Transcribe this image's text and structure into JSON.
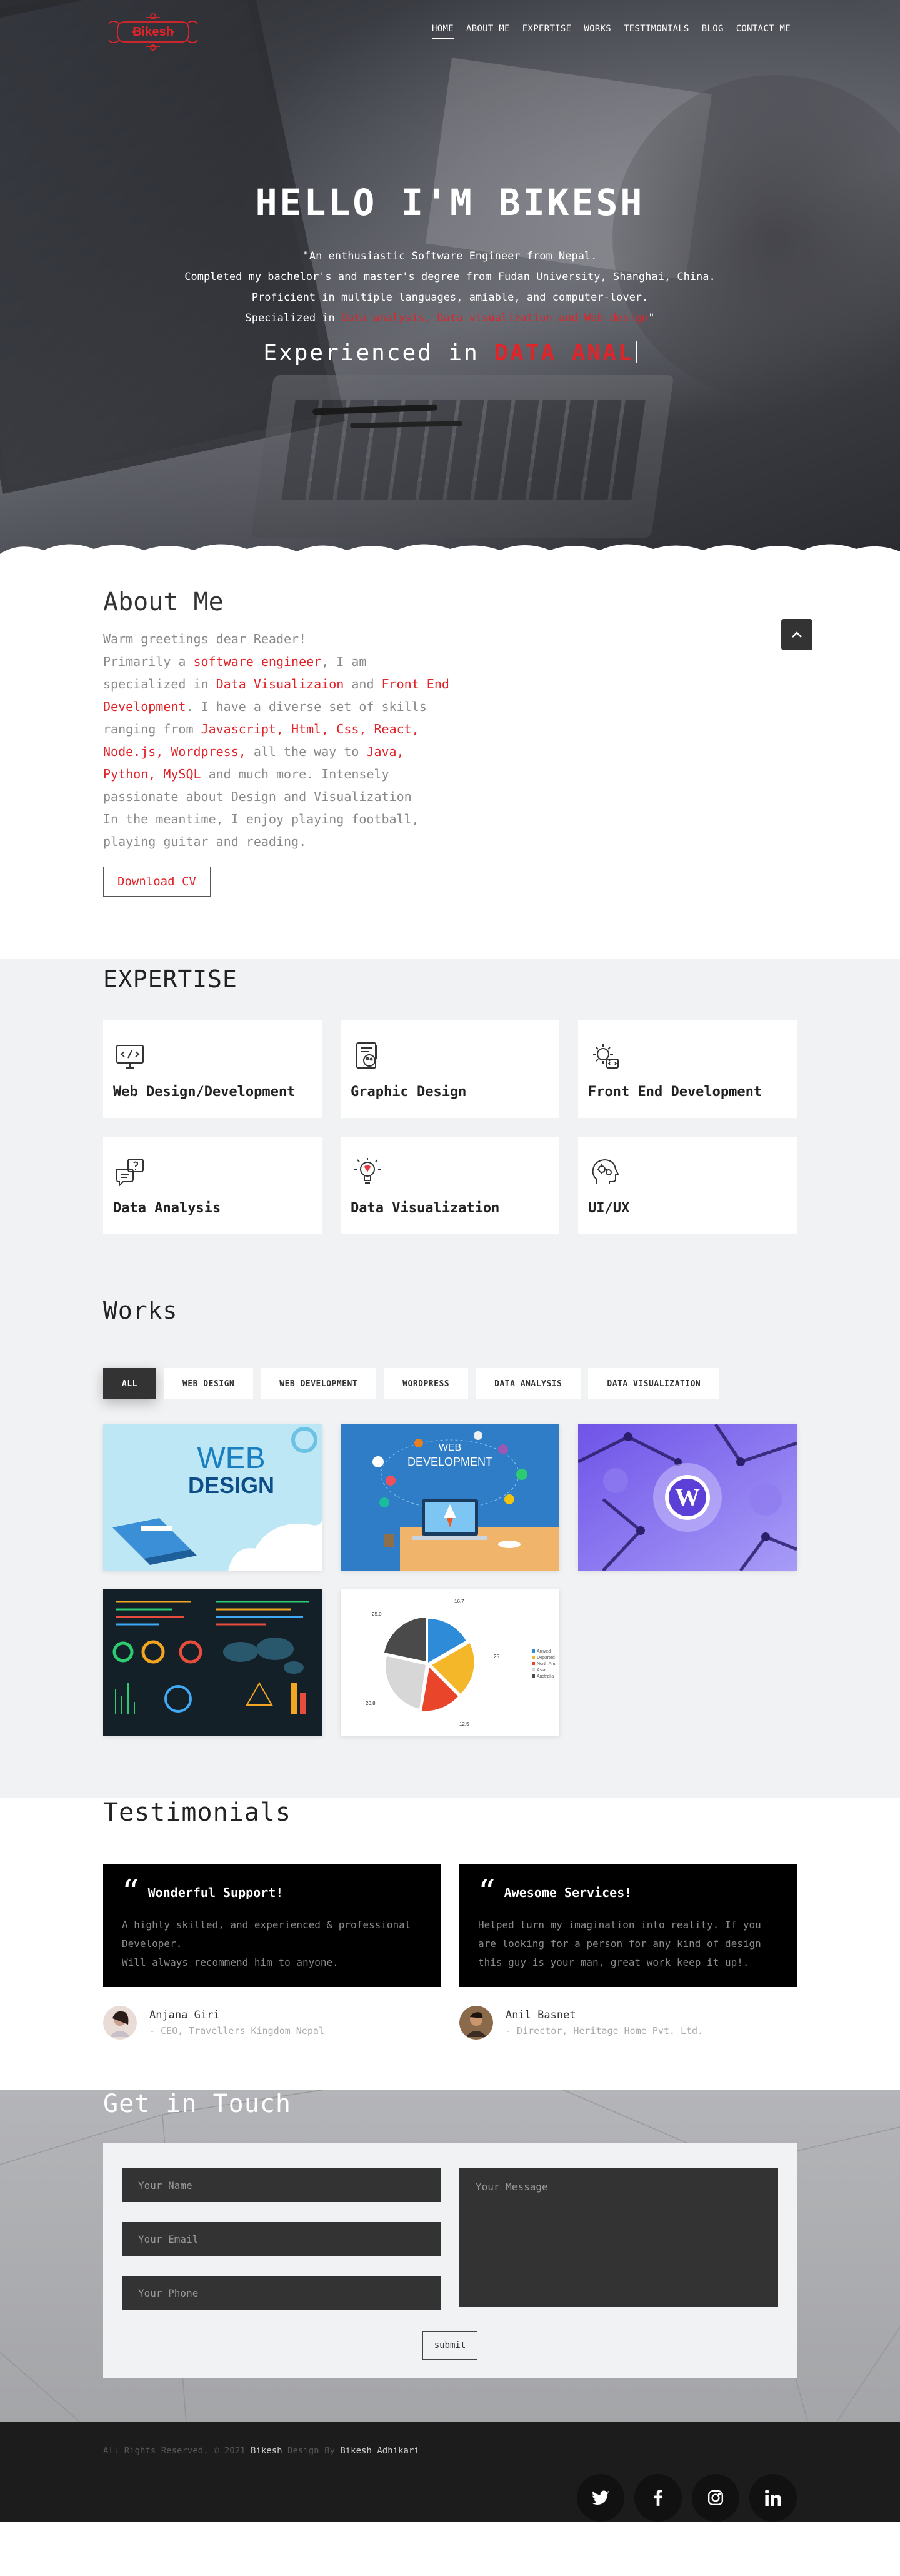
{
  "nav": {
    "logo_text": "Bikesh",
    "links": [
      "HOME",
      "ABOUT ME",
      "EXPERTISE",
      "WORKS",
      "TESTIMONIALS",
      "BLOG",
      "CONTACT ME"
    ]
  },
  "hero": {
    "title": "HELLO I'M BIKESH",
    "line1": "\"An enthusiastic Software Engineer from Nepal.",
    "line2": "Completed my bachelor's and master's degree from Fudan University, Shanghai, China.",
    "line3": "Proficient in multiple languages, amiable, and computer-lover.",
    "line4_prefix": "Specialized in ",
    "line4_red": "Data analysis, Data visualization and Web design",
    "line4_suffix": "\"",
    "typed_prefix": "Experienced in ",
    "typed_value": "DATA ANAL"
  },
  "about": {
    "heading": "About Me",
    "p1": "Warm greetings dear Reader!",
    "p2a": "Primarily a ",
    "p2b": "software engineer",
    "p2c": ", I am specialized in ",
    "p2d": "Data Visualizaion",
    "p2e": " and ",
    "p2f": "Front End Development",
    "p2g": ". I have a diverse set of skills ranging from ",
    "p2h": "Javascript, Html, Css, React, Node.js, Wordpress,",
    "p2i": " all the way to ",
    "p2j": "Java, Python, MySQL",
    "p2k": " and much more. Intensely passionate about Design and Visualization",
    "p3": "In the meantime, I enjoy playing football, playing guitar and reading.",
    "download_label": "Download CV"
  },
  "expertise": {
    "heading": "EXPERTISE",
    "items": [
      {
        "title": "Web Design/Development",
        "icon": "monitor-code-icon"
      },
      {
        "title": "Graphic Design",
        "icon": "palette-document-icon"
      },
      {
        "title": "Front End Development",
        "icon": "gear-code-icon"
      },
      {
        "title": "Data Analysis",
        "icon": "chat-question-icon"
      },
      {
        "title": "Data Visualization",
        "icon": "lightbulb-icon"
      },
      {
        "title": "UI/UX",
        "icon": "head-gears-icon"
      }
    ]
  },
  "works": {
    "heading": "Works",
    "filters": [
      "ALL",
      "WEB DESIGN",
      "WEB DEVELOPMENT",
      "WORDPRESS",
      "DATA ANALYSIS",
      "DATA VISUALIZATION"
    ],
    "web_design_text_1": "WEB",
    "web_design_text_2": "DESIGN",
    "web_dev_text_1": "WEB",
    "web_dev_text_2": "DEVELOPMENT",
    "pie_labels": [
      "16.7",
      "25",
      "12.5",
      "20.8",
      "25.0"
    ],
    "pie_legend": [
      "Arrived",
      "Departed",
      "North Am.",
      "Asia",
      "Australia"
    ]
  },
  "testimonials": {
    "heading": "Testimonials",
    "items": [
      {
        "title": "Wonderful Support!",
        "body": "A highly skilled, and experienced & professional Developer.\nWill always recommend him to anyone.",
        "name": "Anjana Giri",
        "role": "- CEO, Travellers Kingdom Nepal"
      },
      {
        "title": "Awesome Services!",
        "body": "Helped turn my imagination into reality. If you are looking for a person for any kind of design this guy is your man, great work keep it up!.",
        "name": "Anil Basnet",
        "role": "- Director, Heritage Home Pvt. Ltd."
      }
    ]
  },
  "contact": {
    "heading": "Get in Touch",
    "name_placeholder": "Your Name",
    "email_placeholder": "Your Email",
    "phone_placeholder": "Your Phone",
    "message_placeholder": "Your Message",
    "submit_label": "submit"
  },
  "footer": {
    "copy_prefix": "All Rights Reserved. © 2021 ",
    "copy_brand": "Bikesh",
    "copy_mid": " Design By  ",
    "copy_author": "Bikesh Adhikari",
    "socials": [
      "twitter-icon",
      "facebook-icon",
      "instagram-icon",
      "linkedin-icon"
    ]
  },
  "colors": {
    "accent": "#e0242a",
    "dark": "#333333",
    "section_bg": "#f1f2f4",
    "footer_bg": "#1c1c1c"
  }
}
